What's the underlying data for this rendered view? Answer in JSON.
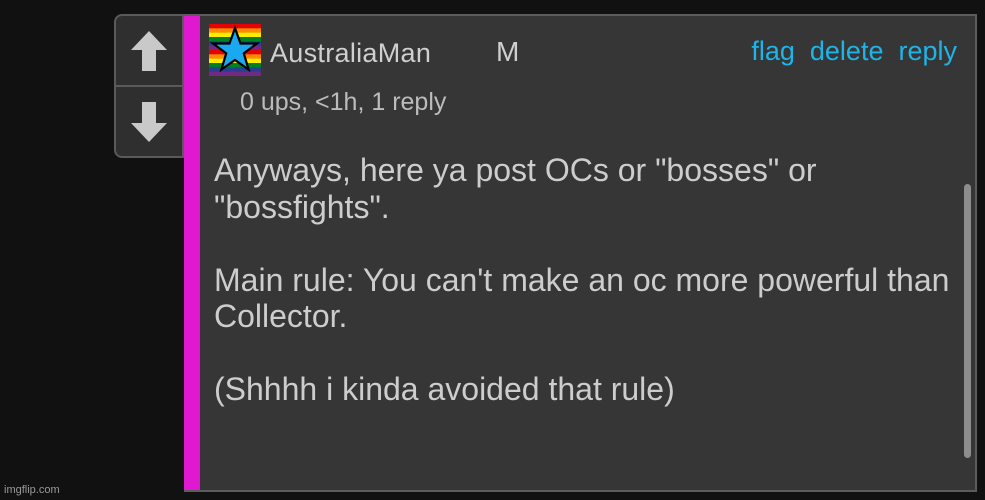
{
  "comment": {
    "username": "AustraliaMan",
    "user_badge": "M",
    "meta": "0 ups, <1h, 1 reply",
    "actions": {
      "flag": "flag",
      "delete": "delete",
      "reply": "reply"
    },
    "body": [
      "Anyways, here ya post OCs or \"bosses\" or \"bossfights\".",
      "Main rule: You can't make an oc more powerful than Collector.",
      "(Shhhh i kinda avoided that rule)"
    ]
  },
  "votes": {
    "up_icon": "arrow-up-icon",
    "down_icon": "arrow-down-icon"
  },
  "avatar": {
    "icon": "rainbow-star-avatar",
    "colors": [
      "#e40303",
      "#ff8c00",
      "#ffed00",
      "#008026",
      "#24408e",
      "#732982"
    ],
    "star_color": "#1aa8f0"
  },
  "colors": {
    "accent_bar": "#e019d0",
    "link": "#1fb4e8",
    "card_bg": "#363636"
  },
  "watermark": "imgflip.com"
}
